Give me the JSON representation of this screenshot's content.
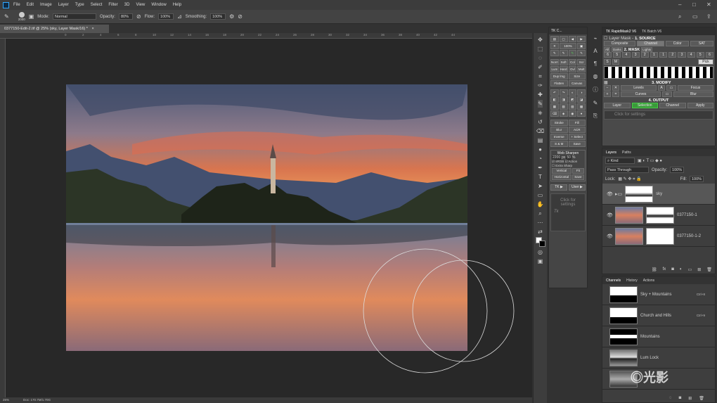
{
  "menubar": {
    "items": [
      "File",
      "Edit",
      "Image",
      "Layer",
      "Type",
      "Select",
      "Filter",
      "3D",
      "View",
      "Window",
      "Help"
    ]
  },
  "options": {
    "brush_size": "2000",
    "mode_label": "Mode:",
    "mode_value": "Normal",
    "opacity_label": "Opacity:",
    "opacity_value": "80%",
    "flow_label": "Flow:",
    "flow_value": "100%",
    "smoothing_label": "Smoothing:",
    "smoothing_value": "100%"
  },
  "document": {
    "tab_title": "0377150-Edit-2.tif @ 25% (sky, Layer Mask/16) *",
    "zoom": "25%",
    "doc_info": "Doc: 170.7M/1.70G",
    "ruler_ticks": [
      "0",
      "2",
      "4",
      "6",
      "8",
      "10",
      "12",
      "14",
      "16",
      "18",
      "20",
      "22",
      "24",
      "26",
      "28",
      "30",
      "32",
      "34",
      "36",
      "38",
      "40",
      "42",
      "44"
    ]
  },
  "tk_panel": {
    "title": "TK C...",
    "row1": [
      "Norm",
      "Soft",
      "Col",
      "Scr"
    ],
    "row2": [
      "Lum",
      "Hard",
      "Ovl",
      "Mult"
    ],
    "row3": [
      "Dup lmg",
      "Size"
    ],
    "row4": [
      "Flatten",
      "Canvas"
    ],
    "row5": [
      "Stroke",
      "Fill"
    ],
    "row6": [
      "Blur",
      "ACR"
    ],
    "row7": [
      "Inverse",
      "+ Select"
    ],
    "row8": [
      "S & M",
      "Save"
    ],
    "web_title": "Web Sharpen",
    "web_px": "2200",
    "web_px_unit": "px",
    "web_pct": "50",
    "web_pct_unit": "%",
    "web_opt1": "sRGB",
    "web_opt2": "Action",
    "web_opt3": "Extra Sharp",
    "web_vertical": "Vertical",
    "web_fit": "Fit",
    "web_horizontal": "Horizontal",
    "web_save": "Save",
    "tk_btn": "TK",
    "user_btn": "User",
    "click_settings": "Click for settings",
    "tk_logo": "Tk"
  },
  "rapidmask": {
    "tab1": "TK RapidMask2 V6",
    "tab2": "TK Batch V6",
    "source_title": "1. SOURCE",
    "layer_mask_label": "Layer Mask -",
    "source_buttons": [
      "Composite",
      "Channel",
      "Color",
      "SAT"
    ],
    "mask_title": "2. MASK",
    "lights_label": "Lights",
    "all_label": "All",
    "darks_label": "Darks",
    "digits1": [
      "6",
      "5",
      "4",
      "3",
      "2",
      "1"
    ],
    "digits2": [
      "1",
      "2",
      "3",
      "4",
      "5",
      "6"
    ],
    "s_label": "S",
    "m_label": "M",
    "pick_label": "Pick",
    "modify_title": "3. MODIFY",
    "levels_label": "Levels",
    "a_label": "A",
    "focus_label": "Focus",
    "curves_label": "Curves",
    "blur_label": "Blur",
    "output_title": "4. OUTPUT",
    "output_buttons": [
      "Layer",
      "Selection",
      "Channel",
      "Apply"
    ],
    "click_settings": "Click for settings"
  },
  "layers": {
    "tab1": "Layers",
    "tab2": "Paths",
    "kind_label": "Kind",
    "blend_mode": "Pass Through",
    "opacity_label": "Opacity:",
    "opacity_value": "100%",
    "lock_label": "Lock:",
    "fill_label": "Fill:",
    "fill_value": "100%",
    "items": [
      {
        "name": "sky"
      },
      {
        "name": "0377150-1"
      },
      {
        "name": "0377150-1-2"
      }
    ]
  },
  "channels": {
    "tab1": "Channels",
    "tab2": "History",
    "tab3": "Actions",
    "items": [
      {
        "name": "Sky + Mountains",
        "shortcut": "Ctrl+8"
      },
      {
        "name": "Church and Hills",
        "shortcut": "Ctrl+9"
      },
      {
        "name": "Mountains",
        "shortcut": ""
      },
      {
        "name": "Lum Lock",
        "shortcut": ""
      },
      {
        "name": "",
        "shortcut": ""
      }
    ]
  },
  "watermark": "光影"
}
